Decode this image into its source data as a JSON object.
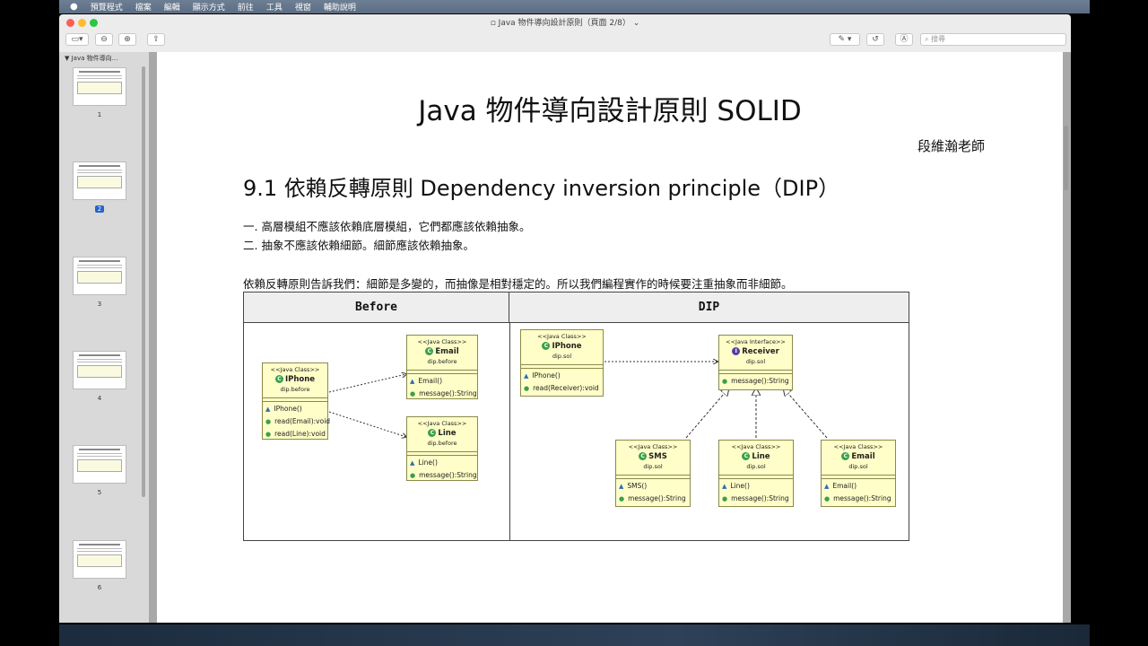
{
  "menubar": {
    "app": "預覽程式",
    "items": [
      "檔案",
      "編輯",
      "顯示方式",
      "前往",
      "工具",
      "視窗",
      "輔助說明"
    ]
  },
  "window": {
    "title": "Java 物件導向設計原則（頁面 2/8）"
  },
  "toolbar": {
    "search_placeholder": "搜尋"
  },
  "sidebar": {
    "header": "Java 物件導向...",
    "pages": [
      "1",
      "2",
      "3",
      "4",
      "5",
      "6"
    ],
    "selected_page": "2"
  },
  "document": {
    "title": "Java  物件導向設計原則  SOLID",
    "author": "段維瀚老師",
    "section": "9.1  依賴反轉原則  Dependency inversion principle（DIP）",
    "points": [
      "一.  高層模組不應該依賴底層模組，它們都應該依賴抽象。",
      "二.  抽象不應該依賴細節。細節應該依賴抽象。"
    ],
    "summary": "依賴反轉原則告訴我們：細節是多變的，而抽像是相對穩定的。所以我們編程實作的時候要注重抽象而非細節。",
    "table": {
      "headers": [
        "Before",
        "DIP"
      ],
      "before": {
        "iphone": {
          "stereo": "<<Java Class>>",
          "name": "IPhone",
          "pkg": "dip.before",
          "ops": [
            "IPhone()",
            "read(Email):void",
            "read(Line):void"
          ]
        },
        "email": {
          "stereo": "<<Java Class>>",
          "name": "Email",
          "pkg": "dip.before",
          "ops": [
            "Email()",
            "message():String"
          ]
        },
        "line": {
          "stereo": "<<Java Class>>",
          "name": "Line",
          "pkg": "dip.before",
          "ops": [
            "Line()",
            "message():String"
          ]
        }
      },
      "dip": {
        "iphone": {
          "stereo": "<<Java Class>>",
          "name": "IPhone",
          "pkg": "dip.sol",
          "ops": [
            "IPhone()",
            "read(Receiver):void"
          ]
        },
        "receiver": {
          "stereo": "<<Java Interface>>",
          "name": "Receiver",
          "pkg": "dip.sol",
          "ops": [
            "message():String"
          ]
        },
        "sms": {
          "stereo": "<<Java Class>>",
          "name": "SMS",
          "pkg": "dip.sol",
          "ops": [
            "SMS()",
            "message():String"
          ]
        },
        "line": {
          "stereo": "<<Java Class>>",
          "name": "Line",
          "pkg": "dip.sol",
          "ops": [
            "Line()",
            "message():String"
          ]
        },
        "email": {
          "stereo": "<<Java Class>>",
          "name": "Email",
          "pkg": "dip.sol",
          "ops": [
            "Email()",
            "message():String"
          ]
        }
      }
    }
  }
}
